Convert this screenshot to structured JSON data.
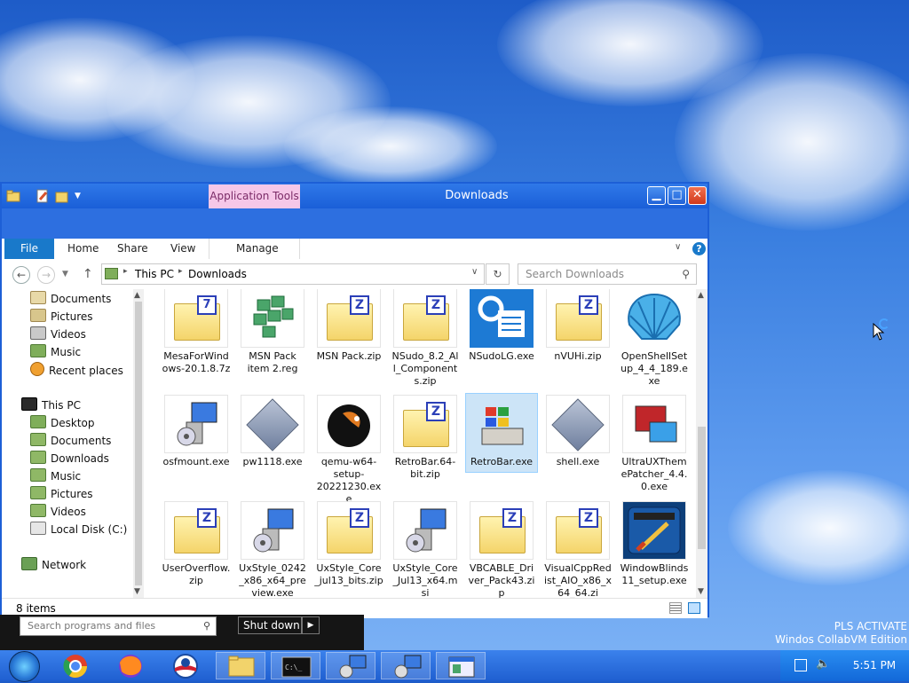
{
  "window": {
    "title": "Downloads",
    "context_tab": "Application Tools",
    "ribbon_tabs": {
      "file": "File",
      "home": "Home",
      "share": "Share",
      "view": "View",
      "manage": "Manage"
    },
    "address": {
      "this_pc": "This PC",
      "folder": "Downloads"
    },
    "search_placeholder": "Search Downloads",
    "status": "8 items"
  },
  "nav_pane": {
    "quick": [
      "Documents",
      "Pictures",
      "Videos",
      "Music",
      "Recent places"
    ],
    "this_pc": "This PC",
    "pc_items": [
      "Desktop",
      "Documents",
      "Downloads",
      "Music",
      "Pictures",
      "Videos",
      "Local Disk (C:)"
    ],
    "network": "Network"
  },
  "files": [
    {
      "name": "MesaForWindows-20.1.8.7z",
      "icon": "7z-archive-icon"
    },
    {
      "name": "MSN Pack item 2.reg",
      "icon": "registry-file-icon"
    },
    {
      "name": "MSN Pack.zip",
      "icon": "zip-archive-icon"
    },
    {
      "name": "NSudo_8.2_All_Components.zip",
      "icon": "zip-archive-icon"
    },
    {
      "name": "NSudoLG.exe",
      "icon": "nsudo-app-icon"
    },
    {
      "name": "nVUHi.zip",
      "icon": "zip-archive-icon"
    },
    {
      "name": "OpenShellSetup_4_4_189.exe",
      "icon": "shell-app-icon"
    },
    {
      "name": "osfmount.exe",
      "icon": "installer-icon"
    },
    {
      "name": "pw1118.exe",
      "icon": "generic-exe-icon"
    },
    {
      "name": "qemu-w64-setup-20221230.exe",
      "icon": "qemu-icon"
    },
    {
      "name": "RetroBar.64-bit.zip",
      "icon": "zip-archive-icon"
    },
    {
      "name": "RetroBar.exe",
      "icon": "retrobar-icon"
    },
    {
      "name": "shell.exe",
      "icon": "generic-exe-icon"
    },
    {
      "name": "UltraUXThemePatcher_4.4.0.exe",
      "icon": "theme-patcher-icon"
    },
    {
      "name": "UserOverflow.zip",
      "icon": "zip-archive-icon"
    },
    {
      "name": "UxStyle_0242_x86_x64_preview.exe",
      "icon": "installer-icon"
    },
    {
      "name": "UxStyle_Core_jul13_bits.zip",
      "icon": "zip-archive-icon"
    },
    {
      "name": "UxStyle_Core_Jul13_x64.msi",
      "icon": "installer-icon"
    },
    {
      "name": "VBCABLE_Driver_Pack43.zip",
      "icon": "zip-archive-icon"
    },
    {
      "name": "VisualCppRedist_AIO_x86_x64_64.zi",
      "icon": "zip-archive-icon"
    },
    {
      "name": "WindowBlinds11_setup.exe",
      "icon": "windowblinds-icon"
    }
  ],
  "start_menu": {
    "search_placeholder": "Search programs and files",
    "shutdown": "Shut down"
  },
  "taskbar": {
    "clock": "5:51 PM"
  },
  "watermark": {
    "line1": "PLS ACTIVATE",
    "line2": "Windos CollabVM Edition"
  },
  "colors": {
    "titlebar": "#1a5fd8",
    "file_tab": "#1979ca",
    "context_tab": "#f6c7e8",
    "close": "#e04a2f",
    "selection": "#cce4f7"
  }
}
